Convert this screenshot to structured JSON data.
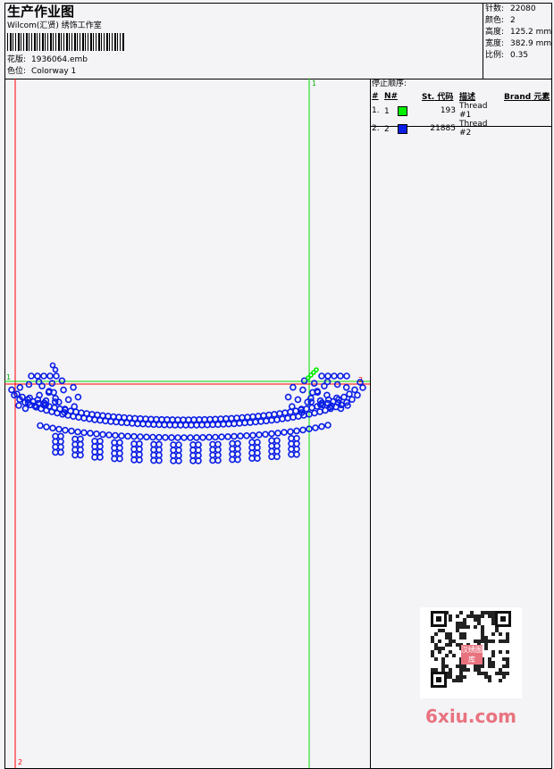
{
  "header": {
    "title": "生产作业图",
    "company": "Wilcom(汇贤) 绣饰工作室",
    "design_label": "花版:",
    "design_value": "1936064.emb",
    "colorway_label": "色位:",
    "colorway_value": "Colorway 1"
  },
  "stats": [
    {
      "label": "针数:",
      "value": "22080"
    },
    {
      "label": "颜色:",
      "value": "2"
    },
    {
      "label": "高度:",
      "value": "125.2 mm"
    },
    {
      "label": "宽度:",
      "value": "382.9 mm"
    },
    {
      "label": "比例:",
      "value": "0.35"
    }
  ],
  "stop_sequence": {
    "label": "停止顺序:",
    "columns": [
      "#",
      "N#",
      "St.",
      "代码",
      "描述",
      "Brand",
      "元素"
    ],
    "rows": [
      {
        "index": "1.",
        "n": "1",
        "color": "#00ee00",
        "stitches": "193",
        "description": "Thread #1"
      },
      {
        "index": "2.",
        "n": "2",
        "color": "#0a1ee6",
        "stitches": "21885",
        "description": "Thread #2"
      }
    ]
  },
  "canvas": {
    "markers": {
      "top_right": "1",
      "left": "1",
      "right": "2",
      "bottom_left": "2"
    },
    "colors": {
      "vertical_red": "#ff0000",
      "vertical_green": "#00dd00",
      "stitch_blue": "#0a1ee6",
      "stitch_green": "#00ee00"
    }
  },
  "watermark": {
    "text": "6xiu.com",
    "qr_badge": "汉绣图库"
  }
}
